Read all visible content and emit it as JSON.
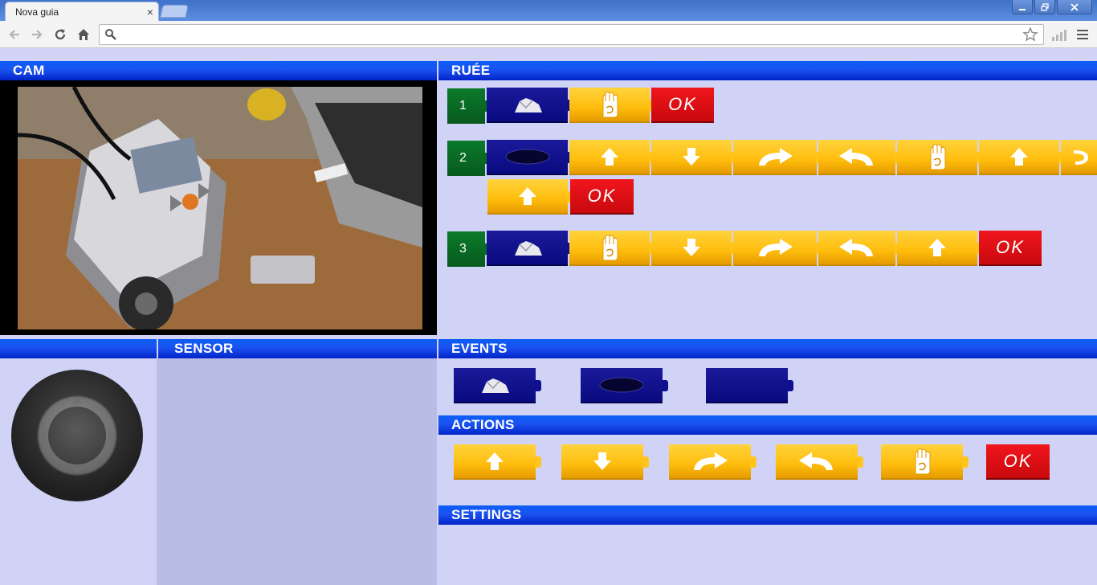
{
  "browser": {
    "tab_title": "Nova guia",
    "tab_close": "×",
    "url": "",
    "window_buttons": [
      "minimize",
      "restore",
      "close"
    ]
  },
  "panels": {
    "cam": "CAM",
    "ruee": "RUÉE",
    "sensor": "SENSOR",
    "events": "EVENTS",
    "actions": "ACTIONS",
    "settings": "SETTINGS"
  },
  "ruee_rows": [
    {
      "number": "1",
      "blocks": [
        "event-rock",
        "hand",
        "ok"
      ]
    },
    {
      "number": "2",
      "blocks": [
        "event-eye",
        "up",
        "down",
        "turn-right",
        "turn-left",
        "hand",
        "up",
        "turn-partial",
        "up",
        "ok"
      ]
    },
    {
      "number": "3",
      "blocks": [
        "event-rock",
        "hand",
        "down",
        "turn-right",
        "turn-left",
        "up",
        "ok"
      ]
    }
  ],
  "events": [
    "event-rock",
    "event-eye",
    "event-empty"
  ],
  "actions": [
    "up",
    "down",
    "turn-right",
    "turn-left",
    "hand",
    "ok"
  ],
  "ok_label": "OK",
  "colors": {
    "header_blue": "#0d5ef8",
    "block_yellow": "#ffbd0c",
    "block_blue": "#090a80",
    "block_red": "#e00d12",
    "block_green": "#096a24",
    "panel_bg": "#d0d2f6",
    "sensor_bg": "#b9bde6"
  }
}
